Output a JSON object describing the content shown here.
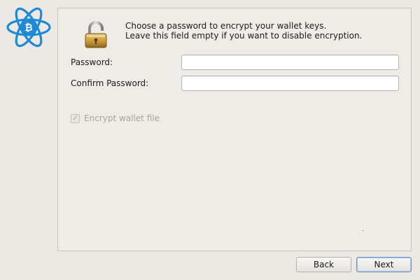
{
  "logo": {
    "icon": "electrum-bitcoin-logo-icon",
    "color": "#1e8ad6"
  },
  "intro": {
    "icon": "lock-icon",
    "line1": "Choose a password to encrypt your wallet keys.",
    "line2": "Leave this field empty if you want to disable encryption."
  },
  "fields": {
    "password_label": "Password:",
    "password_value": "",
    "confirm_label": "Confirm Password:",
    "confirm_value": ""
  },
  "encrypt_checkbox": {
    "label": "Encrypt wallet file",
    "checked": true,
    "enabled": false
  },
  "buttons": {
    "back_label": "Back",
    "next_label": "Next"
  }
}
